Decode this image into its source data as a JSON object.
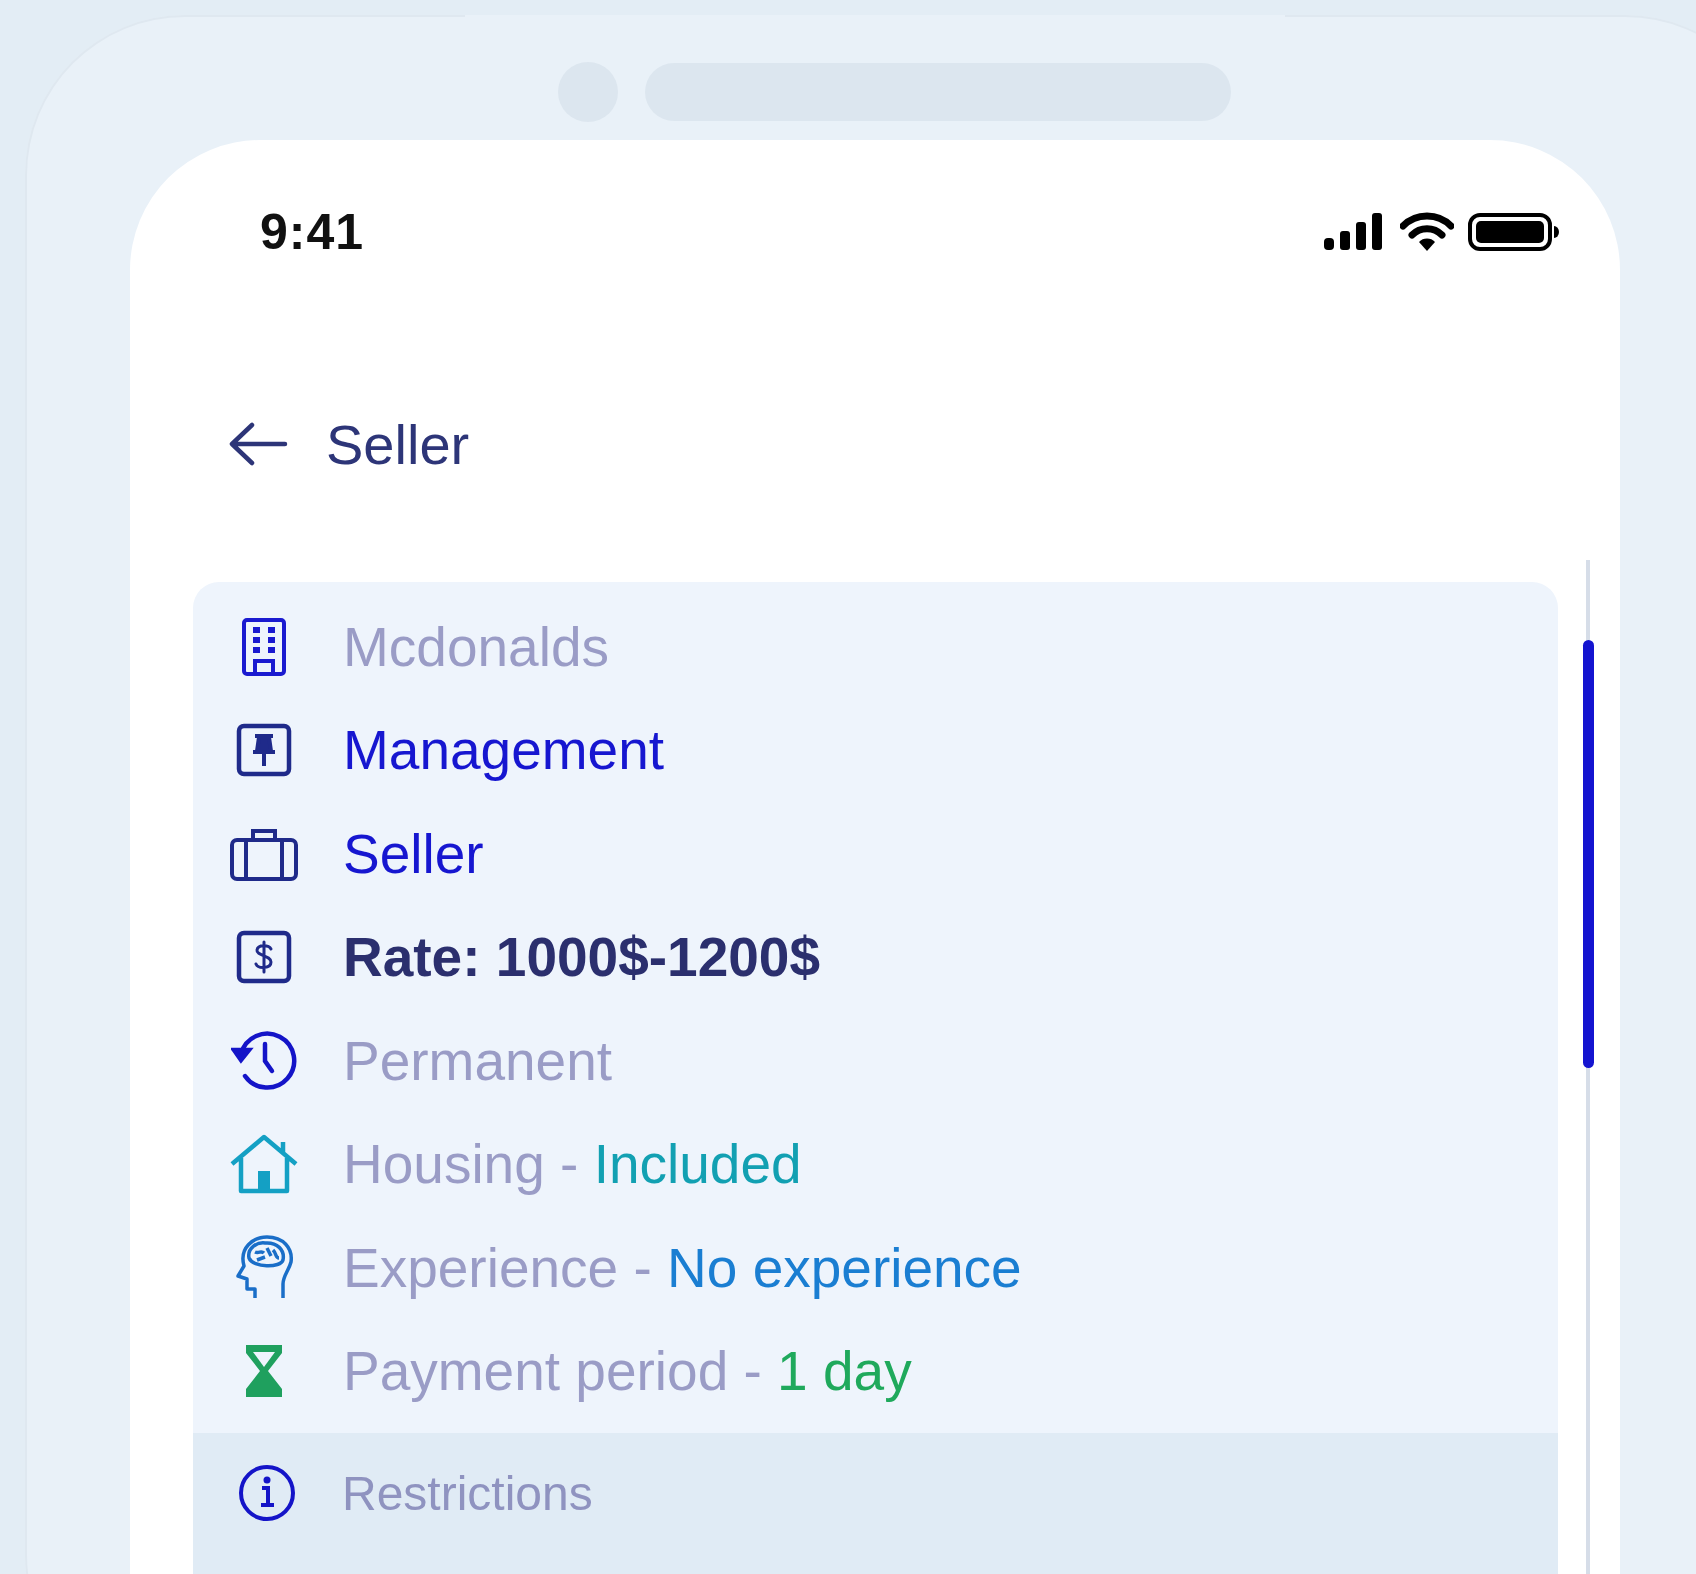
{
  "status_bar": {
    "time": "9:41"
  },
  "header": {
    "title": "Seller"
  },
  "details": [
    {
      "kind": "building",
      "highlighted": false,
      "bold": false,
      "text": "Mcdonalds"
    },
    {
      "kind": "pin",
      "highlighted": true,
      "bold": false,
      "text": "Management"
    },
    {
      "kind": "briefcase",
      "highlighted": true,
      "bold": false,
      "text": "Seller"
    },
    {
      "kind": "money",
      "highlighted": false,
      "bold": true,
      "text": "Rate: 1000$-1200$"
    },
    {
      "kind": "history",
      "highlighted": false,
      "bold": false,
      "text": "Permanent"
    },
    {
      "kind": "house",
      "highlighted": false,
      "bold": false,
      "text": "Housing -",
      "value": "Included",
      "color": "#12a0b2"
    },
    {
      "kind": "brain",
      "highlighted": false,
      "bold": false,
      "text": "Experience -",
      "value": "No experience",
      "color": "#1a7ed2"
    },
    {
      "kind": "hourglass",
      "highlighted": false,
      "bold": false,
      "text": "Payment period -",
      "value": "1 day",
      "color": "#1fa95c"
    }
  ],
  "restrictions": {
    "label": "Restrictions"
  }
}
